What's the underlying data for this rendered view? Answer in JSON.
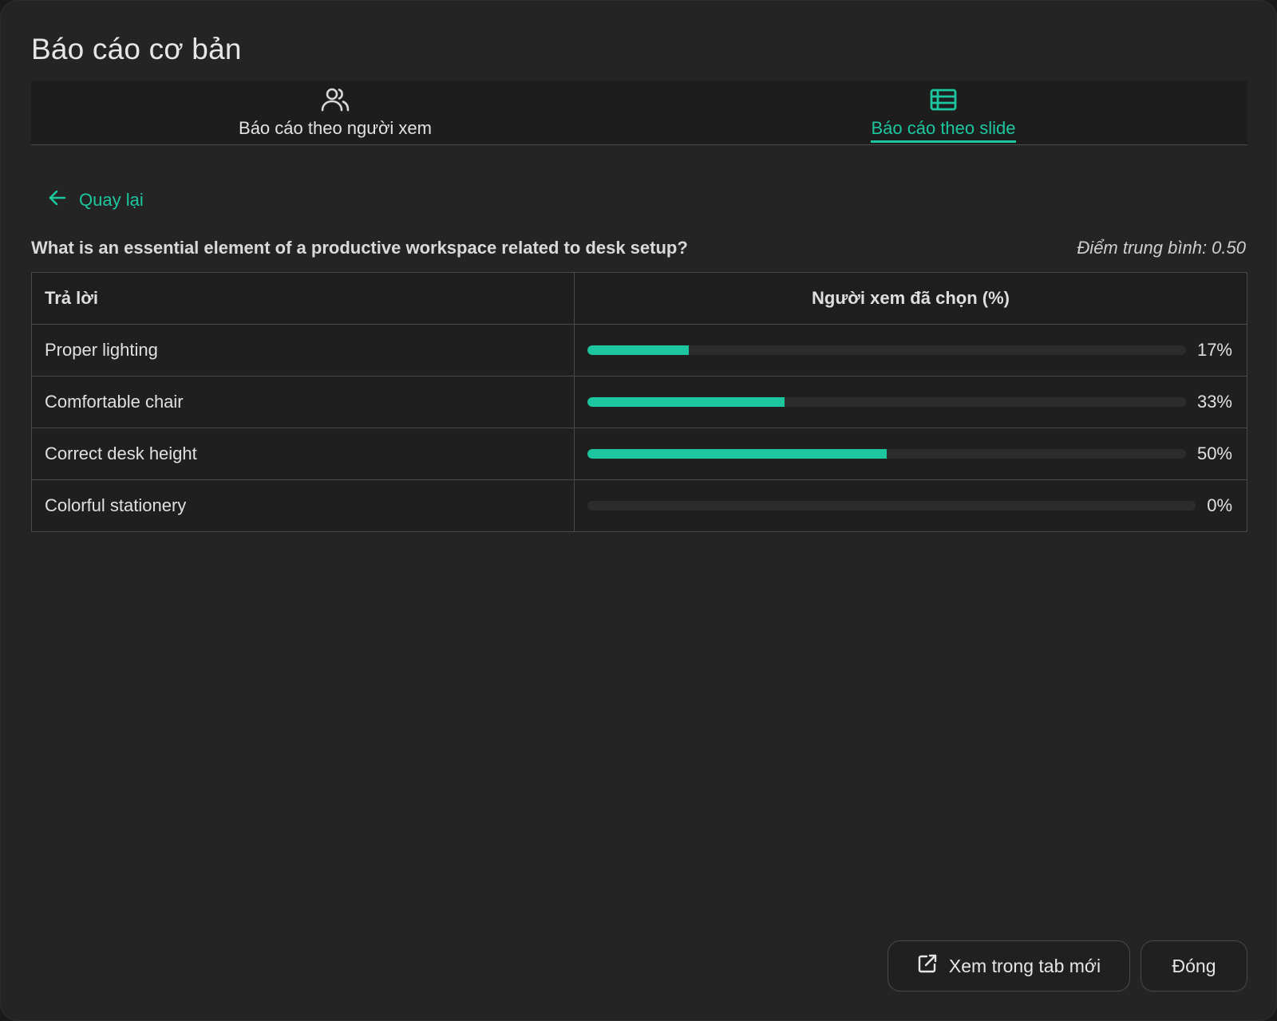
{
  "dialog": {
    "title": "Báo cáo cơ bản"
  },
  "tabs": [
    {
      "label": "Báo cáo theo người xem",
      "icon": "users-icon",
      "active": false
    },
    {
      "label": "Báo cáo theo slide",
      "icon": "table-list-icon",
      "active": true
    }
  ],
  "back": {
    "label": "Quay lại",
    "icon": "arrow-left-icon"
  },
  "question": {
    "text": "What is an essential element of a productive workspace related to desk setup?",
    "average": "Điểm trung bình: 0.50"
  },
  "table": {
    "headers": {
      "answer": "Trả lời",
      "percent": "Người xem đã chọn (%)"
    },
    "rows": [
      {
        "answer": "Proper lighting",
        "percent_label": "17%",
        "percent": 17
      },
      {
        "answer": "Comfortable chair",
        "percent_label": "33%",
        "percent": 33
      },
      {
        "answer": "Correct desk height",
        "percent_label": "50%",
        "percent": 50
      },
      {
        "answer": "Colorful stationery",
        "percent_label": "0%",
        "percent": 0
      }
    ]
  },
  "footer": {
    "open_new_tab": {
      "label": "Xem trong tab mới",
      "icon": "external-link-icon"
    },
    "close": {
      "label": "Đóng"
    }
  },
  "colors": {
    "accent": "#1cc7a0",
    "background": "#242424",
    "border": "#4a4a4a"
  }
}
